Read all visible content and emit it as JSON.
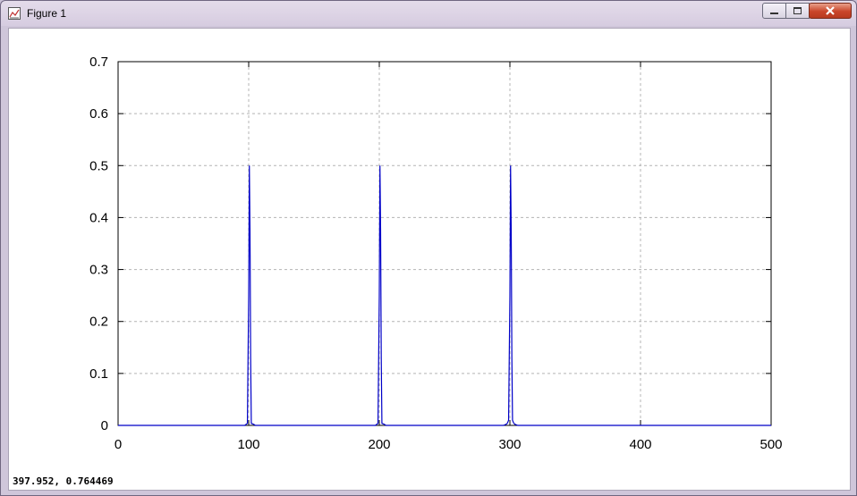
{
  "window": {
    "title": "Figure 1",
    "icons": {
      "app": "figure-plot-icon",
      "minimize": "minimize-icon",
      "maximize": "maximize-icon",
      "close": "close-icon"
    }
  },
  "status": {
    "cursor_readout": "397.952,  0.764469"
  },
  "colors": {
    "line": "#0000c8",
    "grid": "#b4b4b4",
    "axes": "#000000"
  },
  "chart_data": {
    "type": "line",
    "title": "",
    "xlabel": "",
    "ylabel": "",
    "xlim": [
      0,
      500
    ],
    "ylim": [
      0,
      0.7
    ],
    "grid": true,
    "legend": "none",
    "xticks": [
      0,
      100,
      200,
      300,
      400,
      500
    ],
    "yticks": [
      0,
      0.1,
      0.2,
      0.3,
      0.4,
      0.5,
      0.6,
      0.7
    ],
    "xtick_labels": [
      "0",
      "100",
      "200",
      "300",
      "400",
      "500"
    ],
    "ytick_labels": [
      "0",
      "0.1",
      "0.2",
      "0.3",
      "0.4",
      "0.5",
      "0.6",
      "0.7"
    ],
    "series": [
      {
        "color": "#0000c8",
        "x": [
          0,
          97,
          98,
          99,
          100,
          100.5,
          101,
          101.5,
          102,
          103,
          104,
          105,
          197,
          198,
          199,
          200,
          200.5,
          201,
          201.5,
          202,
          203,
          204,
          205,
          295,
          297,
          298,
          299,
          300,
          300.5,
          301,
          301.5,
          302,
          303,
          304,
          306,
          500
        ],
        "y": [
          0,
          0,
          0.002,
          0.004,
          0.25,
          0.5,
          0.375,
          0.13,
          0.004,
          0.003,
          0.002,
          0,
          0,
          0.002,
          0.004,
          0.25,
          0.5,
          0.375,
          0.13,
          0.004,
          0.003,
          0.002,
          0,
          0,
          0.002,
          0.004,
          0.01,
          0.25,
          0.5,
          0.375,
          0.13,
          0.01,
          0.004,
          0.002,
          0,
          0
        ]
      }
    ]
  }
}
